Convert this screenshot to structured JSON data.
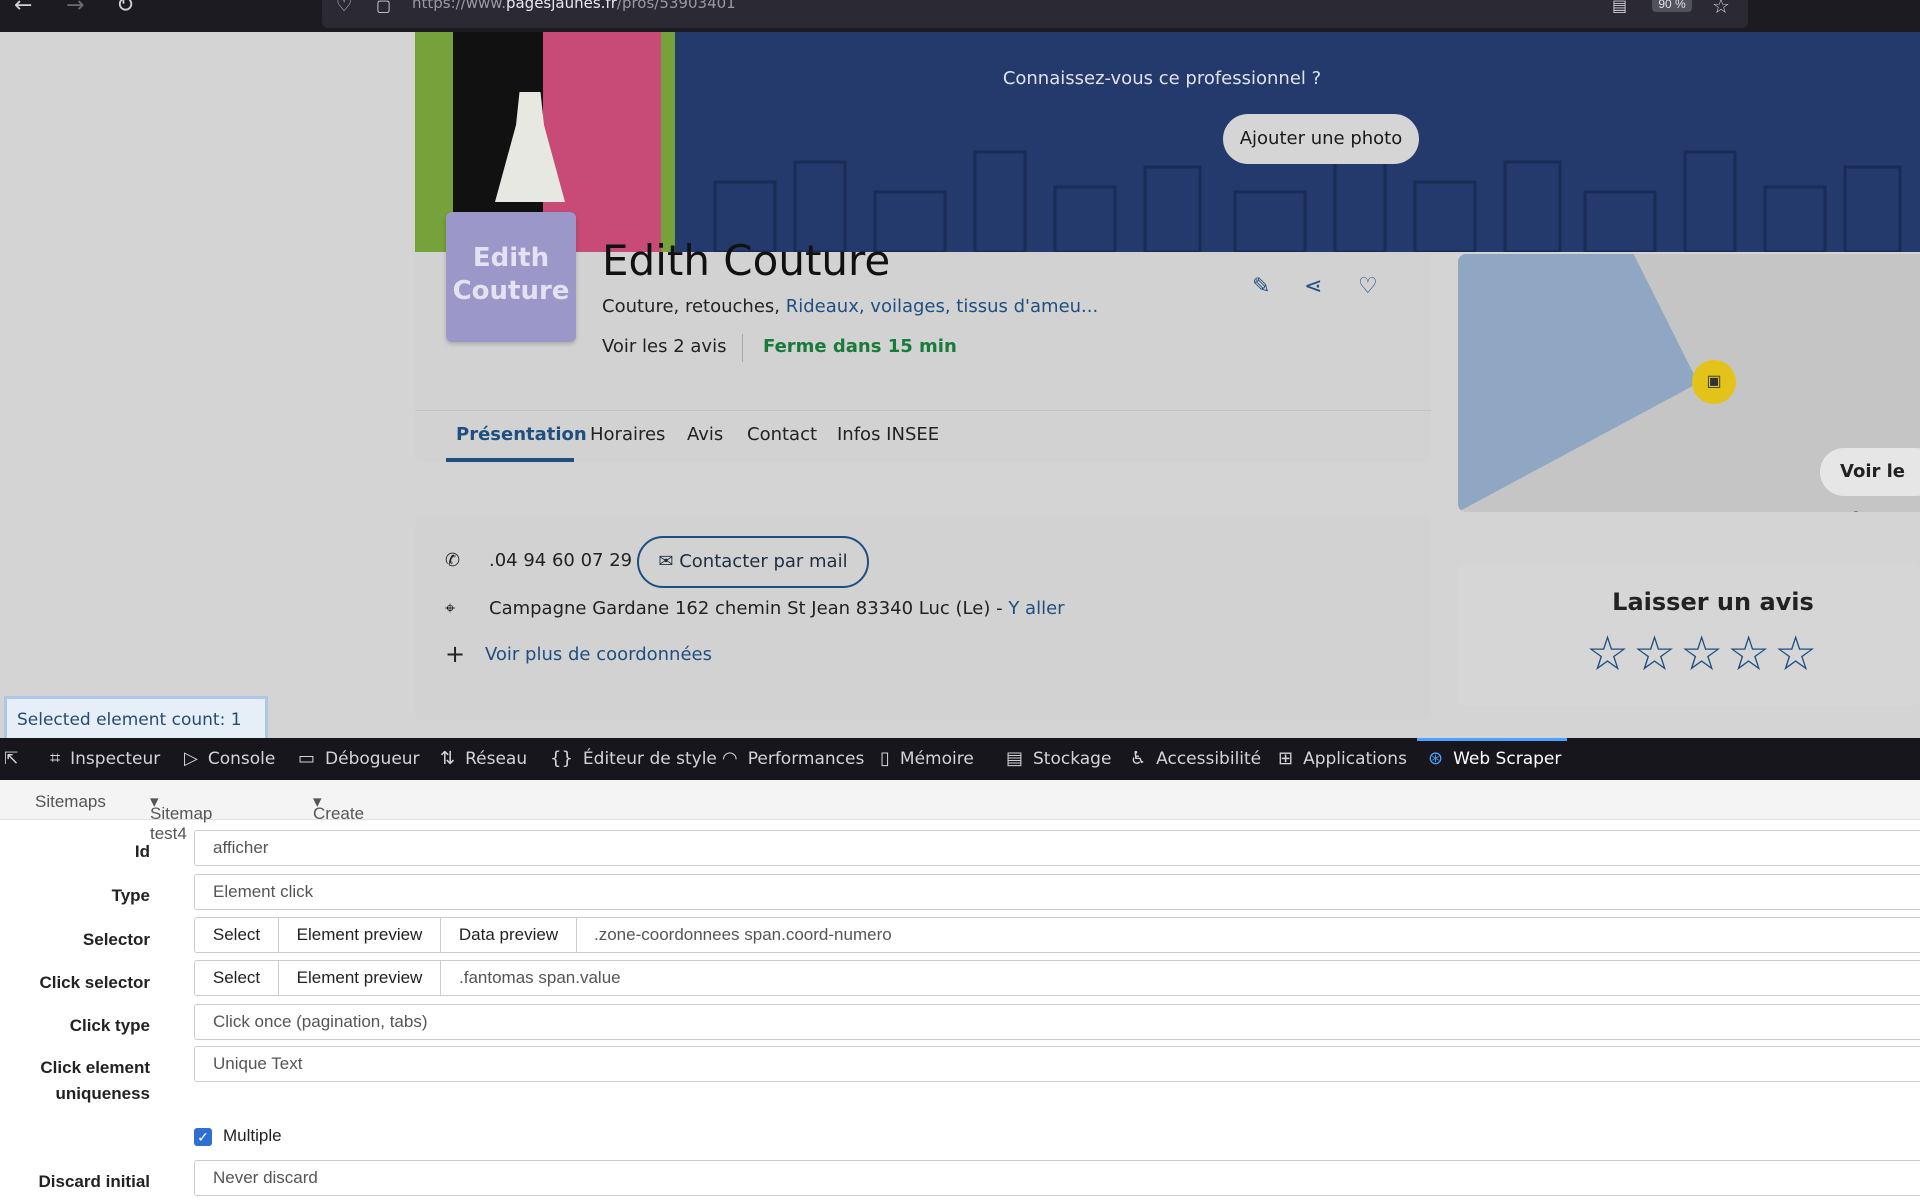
{
  "browser": {
    "url_prefix": "https://www.",
    "url_domain": "pagesjaunes.fr",
    "url_path": "/pros/53903401",
    "zoom": "90 %"
  },
  "banner": {
    "question": "Connaissez-vous ce professionnel ?",
    "add_photo": "Ajouter une photo"
  },
  "business": {
    "logo_line1": "Edith",
    "logo_line2": "Couture",
    "name": "Edith Couture",
    "categories": "Couture, retouches, ",
    "categories_link": "Rideaux, voilages, tissus d'ameu...",
    "reviews": "Voir les 2 avis",
    "status": "Ferme dans 15 min"
  },
  "tabs": [
    "Présentation",
    "Horaires",
    "Avis",
    "Contact",
    "Infos INSEE"
  ],
  "contact": {
    "phone": ".04 94 60 07 29",
    "mail_button": "Contacter par mail",
    "address": "Campagne Gardane 162 chemin St Jean 83340 Luc (Le)",
    "directions": "Y aller",
    "more": "Voir plus de coordonnées"
  },
  "map": {
    "view_button": "Voir le pla"
  },
  "rating": {
    "title": "Laisser un avis",
    "stars": "☆☆☆☆☆"
  },
  "selection": {
    "count_text": "Selected element count: 1"
  },
  "devtools": {
    "tabs": [
      "Inspecteur",
      "Console",
      "Débogueur",
      "Réseau",
      "Éditeur de style",
      "Performances",
      "Mémoire",
      "Stockage",
      "Accessibilité",
      "Applications",
      "Web Scraper"
    ],
    "active_tab": "Web Scraper"
  },
  "webscraper": {
    "nav": {
      "sitemaps": "Sitemaps",
      "sitemap": "Sitemap test4",
      "create": "Create new sitemap"
    },
    "fields": {
      "id_label": "Id",
      "id_value": "afficher",
      "type_label": "Type",
      "type_value": "Element click",
      "selector_label": "Selector",
      "selector_value": ".zone-coordonnees span.coord-numero",
      "click_selector_label": "Click selector",
      "click_selector_value": ".fantomas span.value",
      "click_type_label": "Click type",
      "click_type_value": "Click once (pagination, tabs)",
      "uniq_label_1": "Click element",
      "uniq_label_2": "uniqueness",
      "uniq_value": "Unique Text",
      "multiple_label": "Multiple",
      "discard_label": "Discard initial",
      "discard_value": "Never discard"
    },
    "buttons": {
      "select": "Select",
      "element_preview": "Element preview",
      "data_preview": "Data preview"
    }
  }
}
